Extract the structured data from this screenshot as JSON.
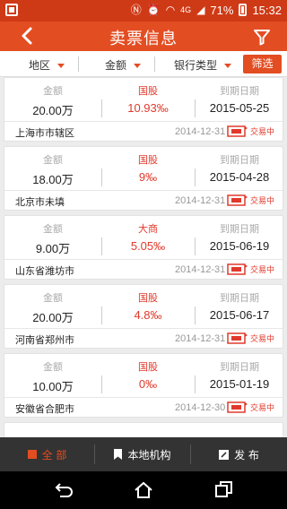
{
  "status_bar": {
    "signal_label": "4G",
    "battery": "71%",
    "time": "15:32"
  },
  "header": {
    "title": "卖票信息"
  },
  "filter_bar": {
    "region": "地区",
    "amount": "金额",
    "bank_type": "银行类型",
    "filter_button": "筛选"
  },
  "columns": {
    "amount": "金额",
    "date": "到期日期"
  },
  "listings": [
    {
      "amount": "20.00万",
      "bank": "国股",
      "rate": "10.93‰",
      "due": "2015-05-25",
      "region": "上海市市辖区",
      "date": "2014-12-31",
      "status": "交易中"
    },
    {
      "amount": "18.00万",
      "bank": "国股",
      "rate": "9‰",
      "due": "2015-04-28",
      "region": "北京市未填",
      "date": "2014-12-31",
      "status": "交易中"
    },
    {
      "amount": "9.00万",
      "bank": "大商",
      "rate": "5.05‰",
      "due": "2015-06-19",
      "region": "山东省潍坊市",
      "date": "2014-12-31",
      "status": "交易中"
    },
    {
      "amount": "20.00万",
      "bank": "国股",
      "rate": "4.8‰",
      "due": "2015-06-17",
      "region": "河南省郑州市",
      "date": "2014-12-31",
      "status": "交易中"
    },
    {
      "amount": "10.00万",
      "bank": "国股",
      "rate": "0‰",
      "due": "2015-01-19",
      "region": "安徽省合肥市",
      "date": "2014-12-30",
      "status": "交易中"
    }
  ],
  "tabs": {
    "all": "全 部",
    "local": "本地机构",
    "publish": "发 布"
  },
  "colors": {
    "primary": "#e34d22",
    "accent_red": "#e03a2c",
    "tabbar": "#333333"
  }
}
